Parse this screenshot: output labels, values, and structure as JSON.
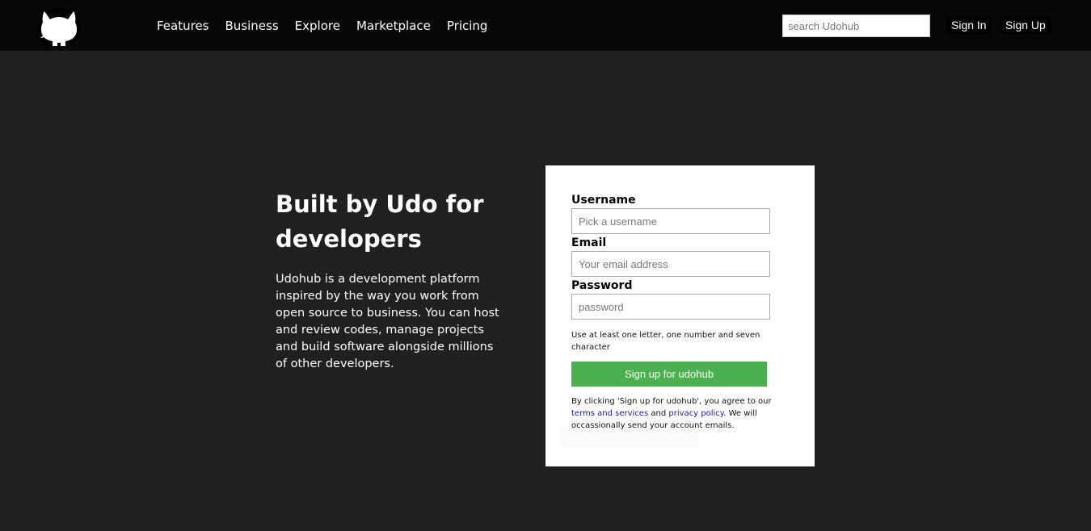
{
  "nav": {
    "items": [
      "Features",
      "Business",
      "Explore",
      "Marketplace",
      "Pricing"
    ]
  },
  "search": {
    "placeholder": "search Udohub"
  },
  "auth": {
    "signin": "Sign In",
    "signup": "Sign Up"
  },
  "hero": {
    "title": "Built by Udo for developers",
    "description": "Udohub is a development platform inspired by the way you work from open source to business. You can host and review codes, manage projects and build software alongside millions of other developers."
  },
  "form": {
    "username_label": "Username",
    "username_placeholder": "Pick a username",
    "email_label": "Email",
    "email_placeholder": "Your email address",
    "password_label": "Password",
    "password_placeholder": "password",
    "hint": "Use at least one letter, one number and seven character",
    "submit": "Sign up for udohub",
    "legal_prefix": "By clicking 'Sign up for udohub', you agree to our",
    "terms_link": "terms and services",
    "legal_and": "and",
    "privacy_link": "privacy policy",
    "legal_suffix": ". We will occassionally send your account emails."
  },
  "colors": {
    "header_bg": "#070707",
    "page_bg": "#202020",
    "primary_button": "#4caf50",
    "link": "#1a1aa6"
  },
  "icons": {
    "logo": "octocat-icon"
  }
}
